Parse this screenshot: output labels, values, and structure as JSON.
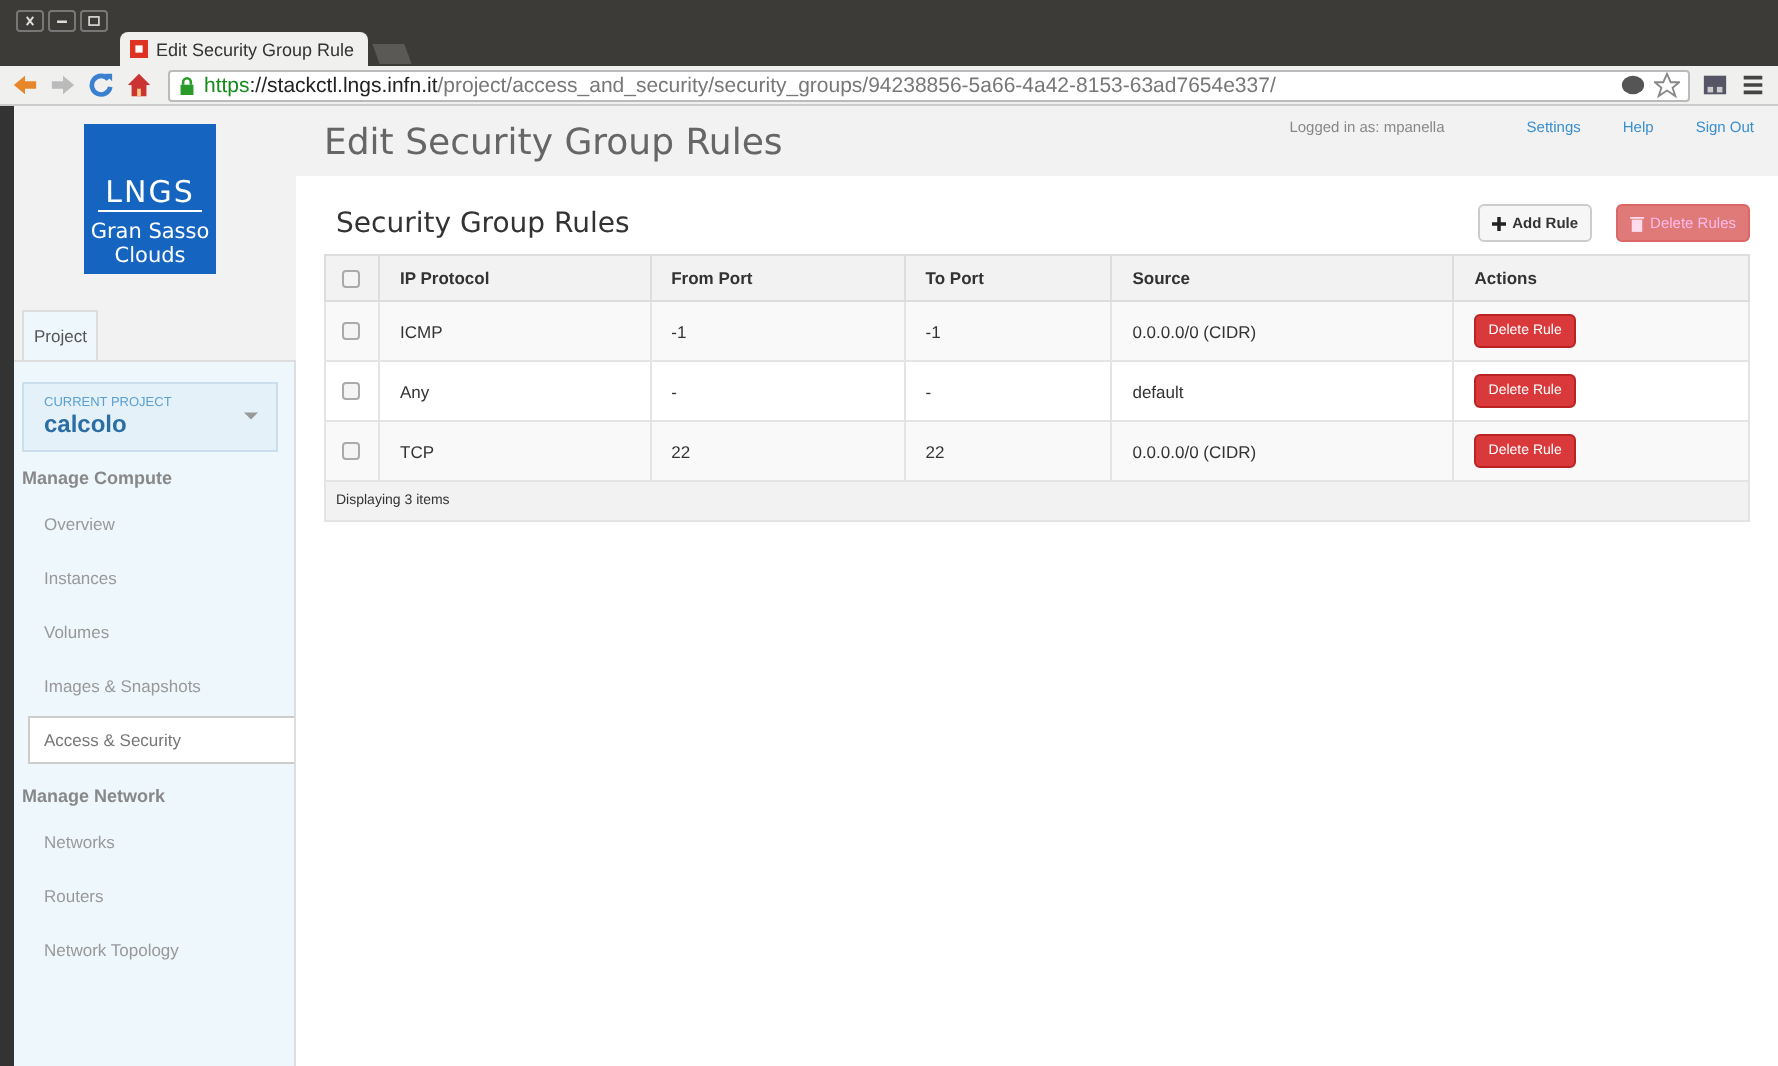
{
  "browser": {
    "tab_title": "Edit Security Group Rule",
    "address": {
      "scheme": "https",
      "separator": "://",
      "host": "stackctl.lngs.infn.it",
      "path": "/project/access_and_security/security_groups/94238856-5a66-4a42-8153-63ad7654e337/"
    }
  },
  "logo": {
    "mark": "LNGS",
    "caption": "Gran Sasso Clouds"
  },
  "sidebar": {
    "tabs": [
      {
        "label": "Project",
        "selected": true
      }
    ],
    "project_switcher": {
      "label": "CURRENT PROJECT",
      "value": "calcolo"
    },
    "sections": [
      {
        "title": "Manage Compute",
        "items": [
          {
            "label": "Overview",
            "selected": false
          },
          {
            "label": "Instances",
            "selected": false
          },
          {
            "label": "Volumes",
            "selected": false
          },
          {
            "label": "Images & Snapshots",
            "selected": false
          },
          {
            "label": "Access & Security",
            "selected": true
          }
        ]
      },
      {
        "title": "Manage Network",
        "items": [
          {
            "label": "Networks",
            "selected": false
          },
          {
            "label": "Routers",
            "selected": false
          },
          {
            "label": "Network Topology",
            "selected": false
          }
        ]
      }
    ]
  },
  "header": {
    "title": "Edit Security Group Rules",
    "user": "Logged in as: mpanella",
    "links": [
      "Settings",
      "Help",
      "Sign Out"
    ]
  },
  "table": {
    "title": "Security Group Rules",
    "actions": [
      {
        "label": "Add Rule",
        "kind": "add"
      },
      {
        "label": "Delete Rules",
        "kind": "delete"
      }
    ],
    "select_all_checked": false,
    "columns": [
      "IP Protocol",
      "From Port",
      "To Port",
      "Source",
      "Actions"
    ],
    "rows": [
      {
        "checked": false,
        "cells": [
          "ICMP",
          "-1",
          "-1",
          "0.0.0.0/0 (CIDR)"
        ],
        "action": "Delete Rule"
      },
      {
        "checked": false,
        "cells": [
          "Any",
          "-",
          "-",
          "default"
        ],
        "action": "Delete Rule"
      },
      {
        "checked": false,
        "cells": [
          "TCP",
          "22",
          "22",
          "0.0.0.0/0 (CIDR)"
        ],
        "action": "Delete Rule"
      }
    ],
    "footer": "Displaying 3 items"
  }
}
